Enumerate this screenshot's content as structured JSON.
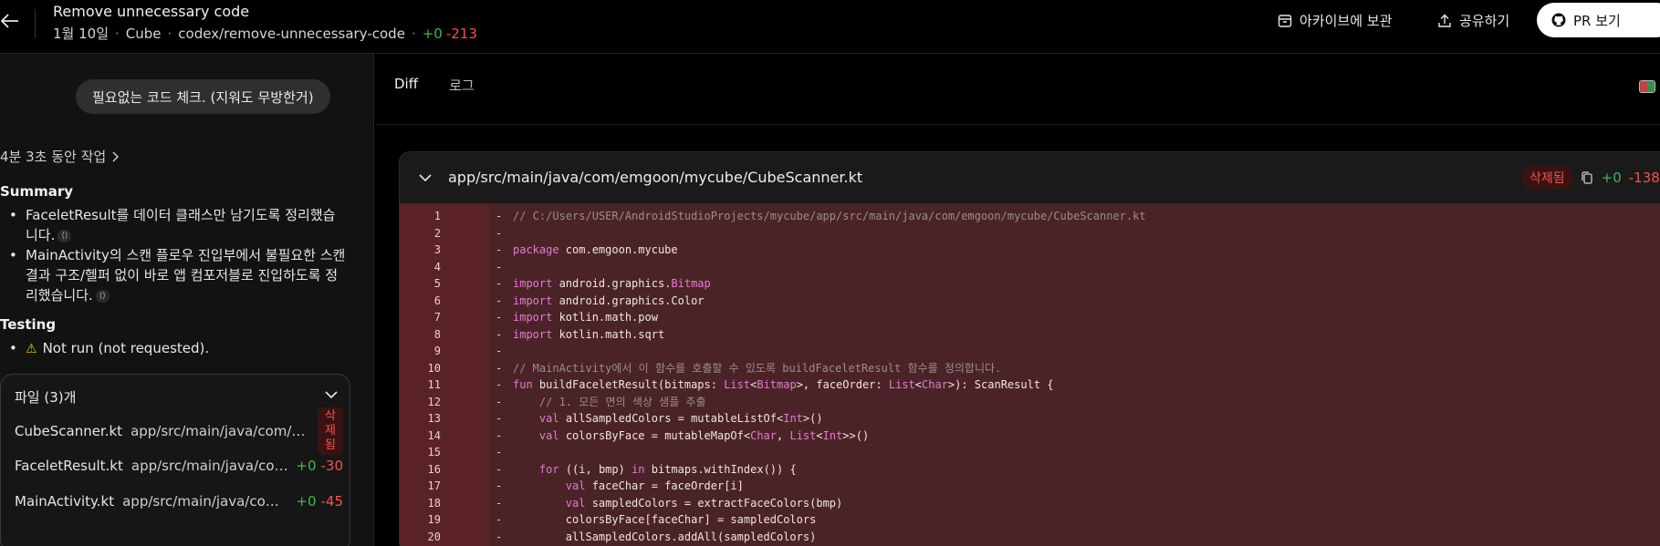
{
  "header": {
    "title": "Remove unnecessary code",
    "date": "1월 10일",
    "repo": "Cube",
    "branch": "codex/remove-unnecessary-code",
    "additions": "+0",
    "deletions": "-213",
    "archive_label": "아카이브에 보관",
    "share_label": "공유하기",
    "pr_label": "PR 보기"
  },
  "left": {
    "prompt": "필요없는 코드 체크. (지워도 무방한거)",
    "worked": "4분 3초 동안 작업",
    "summary_heading": "Summary",
    "summary": [
      "FaceletResult를 데이터 클래스만 남기도록 정리했습니다.",
      "MainActivity의 스캔 플로우 진입부에서 불필요한 스캔 결과 구조/헬퍼 없이 바로 앱 컴포저블로 진입하도록 정리했습니다."
    ],
    "testing_heading": "Testing",
    "testing": [
      "Not run (not requested)."
    ],
    "files_heading": "파일 (3)개",
    "files": [
      {
        "name": "CubeScanner.kt",
        "path": "app/src/main/java/com/e...",
        "badge": "삭제됨",
        "badge_chars": [
          "삭",
          "제",
          "됨"
        ]
      },
      {
        "name": "FaceletResult.kt",
        "path": "app/src/main/java/com/...",
        "add": "+0",
        "del": "-30"
      },
      {
        "name": "MainActivity.kt",
        "path": "app/src/main/java/com/...",
        "add": "+0",
        "del": "-45"
      }
    ]
  },
  "right": {
    "tabs": [
      "Diff",
      "로그"
    ],
    "file_path": "app/src/main/java/com/emgoon/mycube/CubeScanner.kt",
    "badge": "삭제됨",
    "add": "+0",
    "del": "-138",
    "lines": [
      {
        "n": "1",
        "m": "-",
        "t": "// C:/Users/USER/AndroidStudioProjects/mycube/app/src/main/java/com/emgoon/mycube/CubeScanner.kt"
      },
      {
        "n": "2",
        "m": "-",
        "t": ""
      },
      {
        "n": "3",
        "m": "-",
        "t": "package com.emgoon.mycube"
      },
      {
        "n": "4",
        "m": "-",
        "t": ""
      },
      {
        "n": "5",
        "m": "-",
        "t": "import android.graphics.Bitmap"
      },
      {
        "n": "6",
        "m": "-",
        "t": "import android.graphics.Color"
      },
      {
        "n": "7",
        "m": "-",
        "t": "import kotlin.math.pow"
      },
      {
        "n": "8",
        "m": "-",
        "t": "import kotlin.math.sqrt"
      },
      {
        "n": "9",
        "m": "-",
        "t": ""
      },
      {
        "n": "10",
        "m": "-",
        "t": "// MainActivity에서 이 함수를 호출할 수 있도록 buildFaceletResult 함수를 정의합니다."
      },
      {
        "n": "11",
        "m": "-",
        "t": "fun buildFaceletResult(bitmaps: List<Bitmap>, faceOrder: List<Char>): ScanResult {"
      },
      {
        "n": "12",
        "m": "-",
        "t": "    // 1. 모든 면의 색상 샘플 추출"
      },
      {
        "n": "13",
        "m": "-",
        "t": "    val allSampledColors = mutableListOf<Int>()"
      },
      {
        "n": "14",
        "m": "-",
        "t": "    val colorsByFace = mutableMapOf<Char, List<Int>>()"
      },
      {
        "n": "15",
        "m": "-",
        "t": ""
      },
      {
        "n": "16",
        "m": "-",
        "t": "    for ((i, bmp) in bitmaps.withIndex()) {"
      },
      {
        "n": "17",
        "m": "-",
        "t": "        val faceChar = faceOrder[i]"
      },
      {
        "n": "18",
        "m": "-",
        "t": "        val sampledColors = extractFaceColors(bmp)"
      },
      {
        "n": "19",
        "m": "-",
        "t": "        colorsByFace[faceChar] = sampledColors"
      },
      {
        "n": "20",
        "m": "-",
        "t": "        allSampledColors.addAll(sampledColors)"
      }
    ]
  }
}
